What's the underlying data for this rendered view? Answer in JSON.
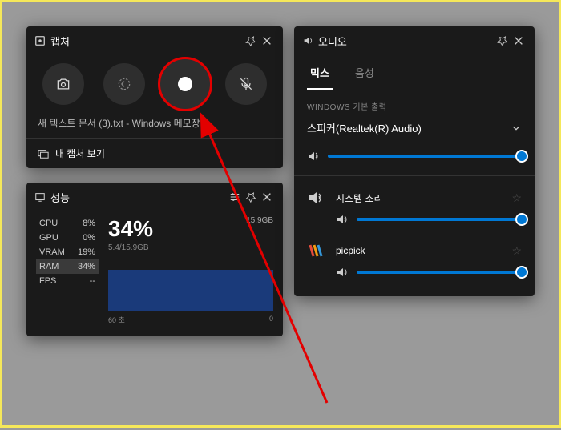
{
  "capture": {
    "title": "캡처",
    "window_name": "새 텍스트 문서 (3).txt - Windows 메모장",
    "link": "내 캡처 보기",
    "icons": {
      "screenshot": "screenshot",
      "last30": "last30",
      "record": "record",
      "mic": "mic-off"
    }
  },
  "perf": {
    "title": "성능",
    "stats": {
      "cpu_label": "CPU",
      "cpu_val": "8%",
      "gpu_label": "GPU",
      "gpu_val": "0%",
      "vram_label": "VRAM",
      "vram_val": "19%",
      "ram_label": "RAM",
      "ram_val": "34%",
      "fps_label": "FPS",
      "fps_val": "--"
    },
    "big": "34%",
    "sub": "5.4/15.9GB",
    "top_right": "15.9GB",
    "x_left": "60 초",
    "x_right": "0"
  },
  "audio": {
    "title": "오디오",
    "tabs": {
      "mix": "믹스",
      "voice": "음성"
    },
    "section_label": "WINDOWS 기본 출력",
    "device": "스피커(Realtek(R) Audio)",
    "apps": [
      {
        "name": "시스템 소리",
        "icon": "system"
      },
      {
        "name": "picpick",
        "icon": "picpick"
      }
    ]
  }
}
